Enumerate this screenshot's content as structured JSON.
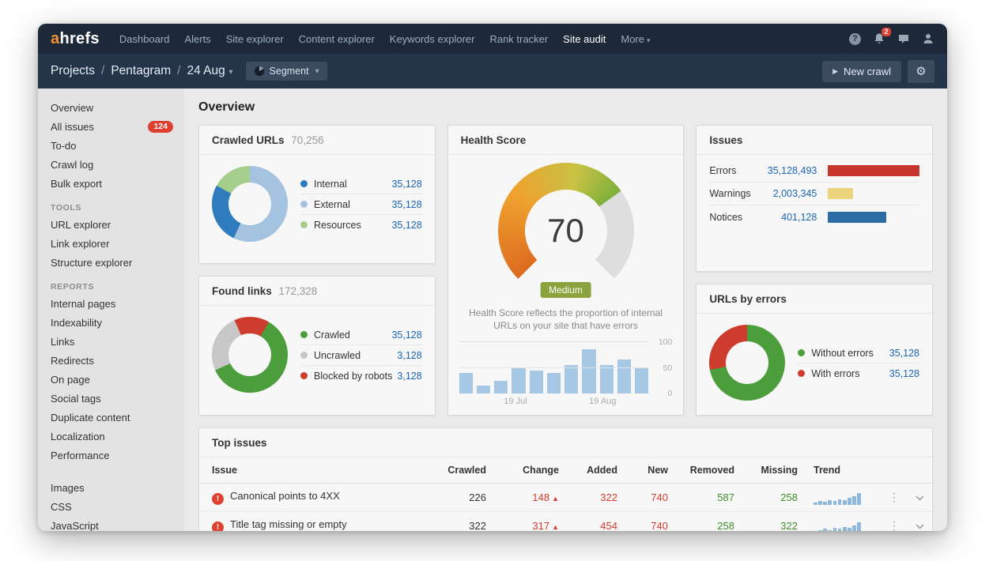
{
  "theme": {
    "navbar": "#1d2938",
    "subbar": "#253549",
    "accent_blue": "#1a65b4",
    "red": "#e0402f",
    "green": "#3f8f29"
  },
  "navbar": {
    "logo_a": "a",
    "logo_rest": "hrefs",
    "items": [
      "Dashboard",
      "Alerts",
      "Site explorer",
      "Content explorer",
      "Keywords explorer",
      "Rank tracker",
      "Site audit",
      "More"
    ],
    "active_item": "Site audit",
    "notification_badge": "2"
  },
  "subheader": {
    "breadcrumb_project": "Projects",
    "breadcrumb_name": "Pentagram",
    "breadcrumb_date": "24 Aug",
    "segment_label": "Segment",
    "new_crawl_label": "New crawl"
  },
  "sidebar": {
    "items_main": [
      "Overview",
      "All issues",
      "To-do",
      "Crawl log",
      "Bulk export"
    ],
    "all_issues_badge": "124",
    "tools_header": "TOOLS",
    "items_tools": [
      "URL explorer",
      "Link explorer",
      "Structure explorer"
    ],
    "reports_header": "REPORTS",
    "items_reports": [
      "Internal pages",
      "Indexability",
      "Links",
      "Redirects",
      "On page",
      "Social tags",
      "Duplicate content",
      "Localization",
      "Performance"
    ],
    "items_resources": [
      "Images",
      "CSS",
      "JavaScript"
    ]
  },
  "main": {
    "page_title": "Overview",
    "crawled_urls": {
      "title": "Crawled URLs",
      "total": "70,256",
      "legend": [
        {
          "label": "Internal",
          "value": "35,128",
          "color": "#2e7cbe"
        },
        {
          "label": "External",
          "value": "35,128",
          "color": "#a3c3e0"
        },
        {
          "label": "Resources",
          "value": "35,128",
          "color": "#a5cd8c"
        }
      ],
      "donut": {
        "from": 0,
        "segments": [
          {
            "color": "#a3c3e0",
            "value": 57
          },
          {
            "color": "#2e7cbe",
            "value": 26
          },
          {
            "color": "#a5cd8c",
            "value": 17
          }
        ]
      }
    },
    "found_links": {
      "title": "Found links",
      "total": "172,328",
      "legend": [
        {
          "label": "Crawled",
          "value": "35,128",
          "color": "#4c9d3b"
        },
        {
          "label": "Uncrawled",
          "value": "3,128",
          "color": "#c7c7c7"
        },
        {
          "label": "Blocked by robots.txt",
          "value": "3,128",
          "color": "#cd3c2d"
        }
      ],
      "donut": {
        "from": 30,
        "segments": [
          {
            "color": "#4c9d3b",
            "value": 60
          },
          {
            "color": "#c7c7c7",
            "value": 25
          },
          {
            "color": "#cd3c2d",
            "value": 15
          }
        ]
      }
    },
    "health_score": {
      "title": "Health Score",
      "value": "70",
      "rating": "Medium",
      "description": "Health Score reflects the proportion of internal URLs on your site that have errors",
      "gauge": {
        "value": 70,
        "stops": [
          {
            "color": "#dd6b20",
            "deg": 0
          },
          {
            "color": "#efa12e",
            "deg": 80
          },
          {
            "color": "#c8c244",
            "deg": 145
          },
          {
            "color": "#7fb03c",
            "deg": 189
          }
        ],
        "track": "#dedede"
      },
      "chart": {
        "type": "bar",
        "values": [
          40,
          15,
          25,
          50,
          45,
          40,
          55,
          85,
          55,
          65,
          50
        ],
        "x_labels": [
          "19 Jul",
          "19 Aug"
        ],
        "y_ticks": [
          "100",
          "50",
          "0"
        ],
        "bar_color": "#a6c8e4"
      }
    },
    "issues": {
      "title": "Issues",
      "rows": [
        {
          "label": "Errors",
          "value": "35,128,493",
          "color": "#c8372d",
          "pct": 100
        },
        {
          "label": "Warnings",
          "value": "2,003,345",
          "color": "#ecd47c",
          "pct": 27
        },
        {
          "label": "Notices",
          "value": "401,128",
          "color": "#2c6ca5",
          "pct": 64
        }
      ]
    },
    "urls_by_errors": {
      "title": "URLs by errors",
      "legend": [
        {
          "label": "Without errors",
          "value": "35,128",
          "color": "#4c9d3b"
        },
        {
          "label": "With errors",
          "value": "35,128",
          "color": "#cd3c2d"
        }
      ],
      "donut": {
        "from": 0,
        "segments": [
          {
            "color": "#4c9d3b",
            "value": 72
          },
          {
            "color": "#cd3c2d",
            "value": 28
          }
        ]
      }
    },
    "top_issues": {
      "title": "Top issues",
      "columns": [
        "Issue",
        "Crawled",
        "Change",
        "Added",
        "New",
        "Removed",
        "Missing",
        "Trend"
      ],
      "rows": [
        {
          "issue": "Canonical points to 4XX",
          "crawled": "226",
          "change": "148",
          "added": "322",
          "new": "740",
          "removed": "587",
          "missing": "258",
          "trend": [
            15,
            25,
            20,
            30,
            25,
            35,
            30,
            45,
            60,
            80
          ]
        },
        {
          "issue": "Title tag missing or empty",
          "crawled": "322",
          "change": "317",
          "added": "454",
          "new": "740",
          "removed": "258",
          "missing": "322",
          "trend": [
            12,
            20,
            28,
            22,
            35,
            30,
            42,
            38,
            55,
            75
          ]
        }
      ]
    }
  }
}
